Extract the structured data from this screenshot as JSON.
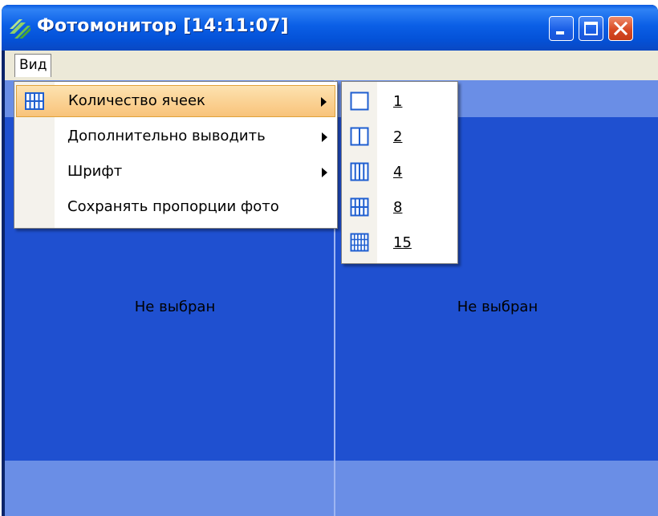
{
  "window": {
    "title": "Фотомонитор  [14:11:07]"
  },
  "menubar": {
    "items": [
      {
        "label": "Вид"
      }
    ]
  },
  "dropdown": {
    "items": [
      {
        "label": "Количество ячеек",
        "icon": "grid-icon",
        "has_submenu": true,
        "highlighted": true
      },
      {
        "label": "Дополнительно выводить",
        "has_submenu": true
      },
      {
        "label": "Шрифт",
        "has_submenu": true
      },
      {
        "label": "Сохранять пропорции фото",
        "has_submenu": false
      }
    ]
  },
  "submenu": {
    "items": [
      {
        "label": "1",
        "icon": "one-cell-icon"
      },
      {
        "label": "2",
        "icon": "two-cells-icon"
      },
      {
        "label": "4",
        "icon": "four-cells-icon"
      },
      {
        "label": "8",
        "icon": "eight-cells-icon"
      },
      {
        "label": "15",
        "icon": "fifteen-cells-icon"
      }
    ]
  },
  "cells": [
    {
      "status": "Не выбран"
    },
    {
      "status": "Не выбран"
    }
  ],
  "colors": {
    "titlebar": "#0b5fe6",
    "cell_background": "#1f50d0",
    "cell_header": "#6a8ee6",
    "menu_highlight": "#f8c37a",
    "icon_blue": "#1f5fd0"
  }
}
